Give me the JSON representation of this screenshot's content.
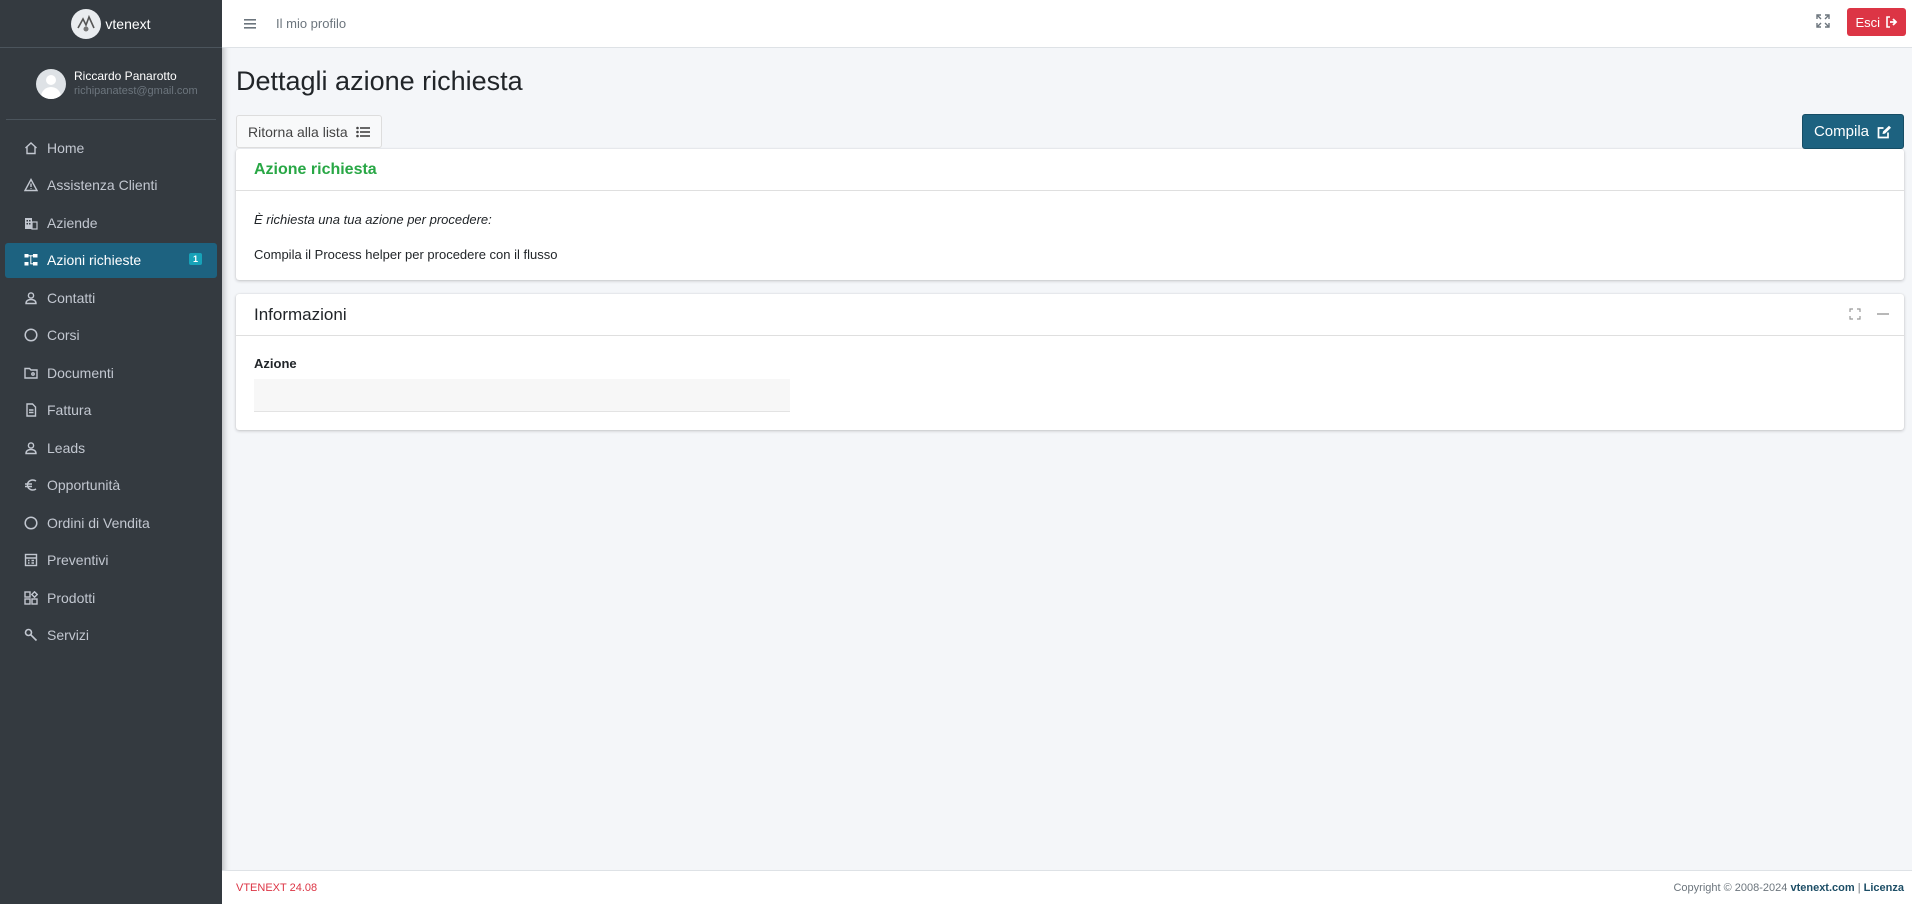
{
  "brand": {
    "name": "vtenext"
  },
  "user": {
    "name": "Riccardo Panarotto",
    "email": "richipanatest@gmail.com"
  },
  "sidebar": {
    "items": [
      {
        "label": "Home",
        "icon": "home-icon"
      },
      {
        "label": "Assistenza Clienti",
        "icon": "warning-icon"
      },
      {
        "label": "Aziende",
        "icon": "building-icon"
      },
      {
        "label": "Azioni richieste",
        "icon": "sitemap-icon",
        "active": true,
        "badge": "1"
      },
      {
        "label": "Contatti",
        "icon": "person-icon"
      },
      {
        "label": "Corsi",
        "icon": "circle-icon"
      },
      {
        "label": "Documenti",
        "icon": "folder-icon"
      },
      {
        "label": "Fattura",
        "icon": "file-icon"
      },
      {
        "label": "Leads",
        "icon": "person-icon"
      },
      {
        "label": "Opportunità",
        "icon": "euro-icon"
      },
      {
        "label": "Ordini di Vendita",
        "icon": "circle-icon"
      },
      {
        "label": "Preventivi",
        "icon": "calculator-icon"
      },
      {
        "label": "Prodotti",
        "icon": "widgets-icon"
      },
      {
        "label": "Servizi",
        "icon": "wrench-icon"
      }
    ]
  },
  "topbar": {
    "profile_link": "Il mio profilo",
    "logout_label": "Esci"
  },
  "page": {
    "title": "Dettagli azione richiesta",
    "back_label": "Ritorna alla lista",
    "compila_label": "Compila"
  },
  "card_azione": {
    "title": "Azione richiesta",
    "italic_text": "È richiesta una tua azione per procedere:",
    "message": "Compila il Process helper per procedere con il flusso"
  },
  "card_info": {
    "title": "Informazioni",
    "field_label": "Azione",
    "field_value": ""
  },
  "footer": {
    "version": "VTENEXT 24.08",
    "copyright": "Copyright © 2008-2024",
    "site": "vtenext.com",
    "separator": "|",
    "license": "Licenza"
  },
  "colors": {
    "accent": "#1d6280",
    "danger": "#dc3545",
    "success": "#28a745",
    "sidebar": "#343a40"
  }
}
